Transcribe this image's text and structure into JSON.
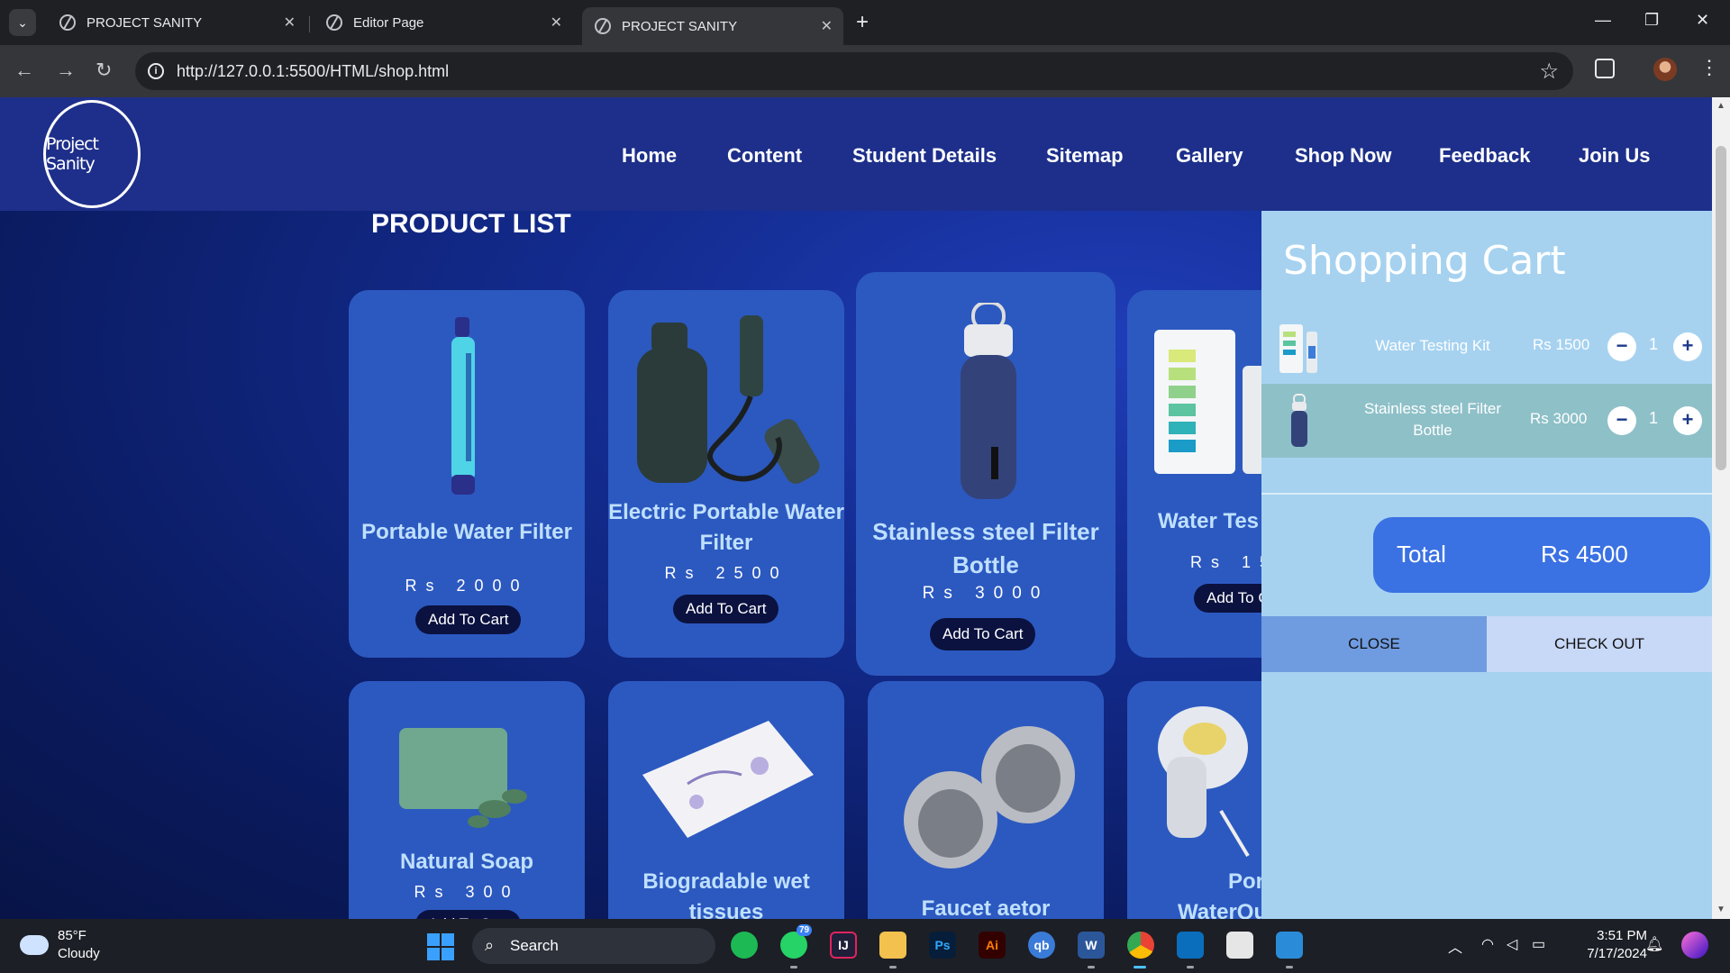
{
  "browser": {
    "tabs": [
      {
        "title": "PROJECT SANITY",
        "active": false
      },
      {
        "title": "Editor Page",
        "active": false
      },
      {
        "title": "PROJECT SANITY",
        "active": true
      }
    ],
    "url": "http://127.0.0.1:5500/HTML/shop.html"
  },
  "site": {
    "logo_text": "Project Sanity",
    "nav": [
      "Home",
      "Content",
      "Student Details",
      "Sitemap",
      "Gallery",
      "Shop Now",
      "Feedback",
      "Join Us"
    ],
    "product_list_title": "PRODUCT LIST"
  },
  "products": [
    {
      "name": "Portable Water Filter",
      "price": "Rs 2000",
      "button": "Add To Cart"
    },
    {
      "name": "Electric Portable Water Filter",
      "price": "Rs 2500",
      "button": "Add To Cart"
    },
    {
      "name": "Stainless steel Filter Bottle",
      "price": "Rs 3000",
      "button": "Add To Cart"
    },
    {
      "name": "Water Tes",
      "price": "Rs 15",
      "button": "Add To C"
    },
    {
      "name": "Natural Soap",
      "price": "Rs 300",
      "button": "Add To Cart"
    },
    {
      "name": "Biogradable wet tissues",
      "price": "",
      "button": ""
    },
    {
      "name": "Faucet aetor",
      "price": "",
      "button": ""
    },
    {
      "name": "Portab",
      "name2": "WaterQu",
      "price": "",
      "button": ""
    }
  ],
  "cart": {
    "title": "Shopping Cart",
    "items": [
      {
        "name": "Water Testing Kit",
        "price": "Rs 1500",
        "qty": "1",
        "minus": "−",
        "plus": "+"
      },
      {
        "name": "Stainless steel Filter Bottle",
        "price": "Rs 3000",
        "qty": "1",
        "minus": "−",
        "plus": "+"
      }
    ],
    "total_label": "Total",
    "total_value": "Rs 4500",
    "close_label": "CLOSE",
    "checkout_label": "CHECK OUT"
  },
  "taskbar": {
    "weather_temp": "85°F",
    "weather_desc": "Cloudy",
    "search_label": "Search",
    "whatsapp_badge": "79",
    "time": "3:51 PM",
    "date": "7/17/2024"
  }
}
